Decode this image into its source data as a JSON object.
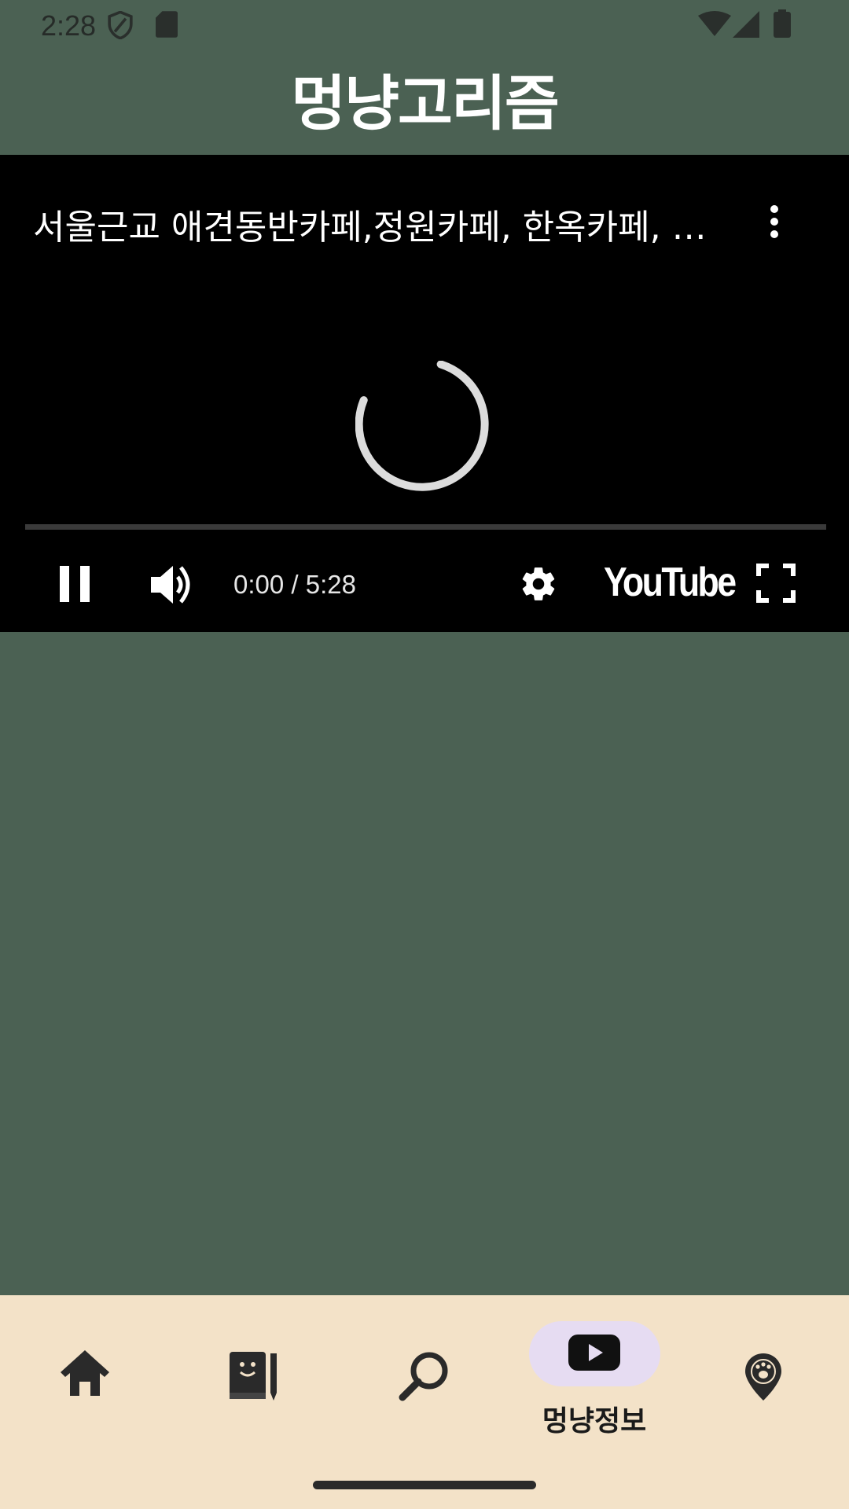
{
  "status_bar": {
    "time": "2:28"
  },
  "app": {
    "title": "멍냥고리즘"
  },
  "player": {
    "video_title": "서울근교 애견동반카페,정원카페, 한옥카페, 강아지 놀이터",
    "time": "0:00 / 5:28",
    "progress": 0,
    "brand": "YouTube"
  },
  "bottom_nav": {
    "items": [
      {
        "icon": "home-icon",
        "label": ""
      },
      {
        "icon": "diary-icon",
        "label": ""
      },
      {
        "icon": "search-icon",
        "label": ""
      },
      {
        "icon": "youtube-play-icon",
        "label": "멍냥정보",
        "selected": true
      },
      {
        "icon": "paw-location-icon",
        "label": ""
      }
    ]
  },
  "colors": {
    "background": "#4b6153",
    "nav_background": "#f3e2c8",
    "selected_pill": "#e6dcf2",
    "player_background": "#000000"
  }
}
